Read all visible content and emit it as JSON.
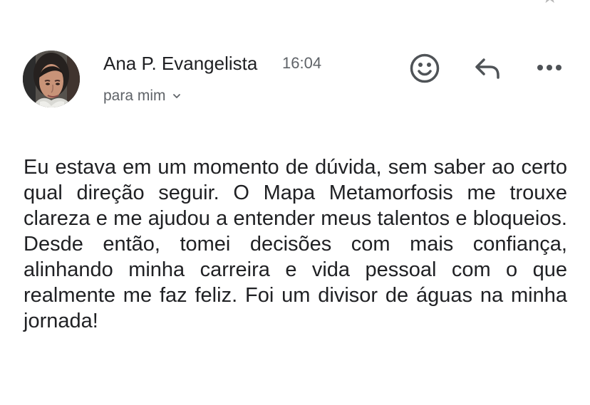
{
  "header": {
    "sender_name": "Ana P. Evangelista",
    "time": "16:04",
    "recipient_label": "para mim",
    "avatar_label": "Ana P. Evangelista profile photo"
  },
  "actions": {
    "emoji_icon": "emoji-reaction-icon",
    "reply_icon": "reply-icon",
    "more_icon": "more-horizontal-icon",
    "star_icon": "star-icon"
  },
  "message": {
    "body": "Eu estava em um momento de dúvida, sem saber ao certo qual direção seguir. O Mapa Metamorfosis me trouxe clareza e me ajudou a entender meus talentos e bloqueios. Desde então, tomei decisões com mais confiança, alinhando minha carreira e vida pessoal com o que realmente me faz feliz. Foi um divisor de águas na minha jornada!"
  },
  "colors": {
    "text_primary": "#202124",
    "text_secondary": "#5f6368",
    "icon": "#4f5357",
    "background": "#ffffff"
  }
}
